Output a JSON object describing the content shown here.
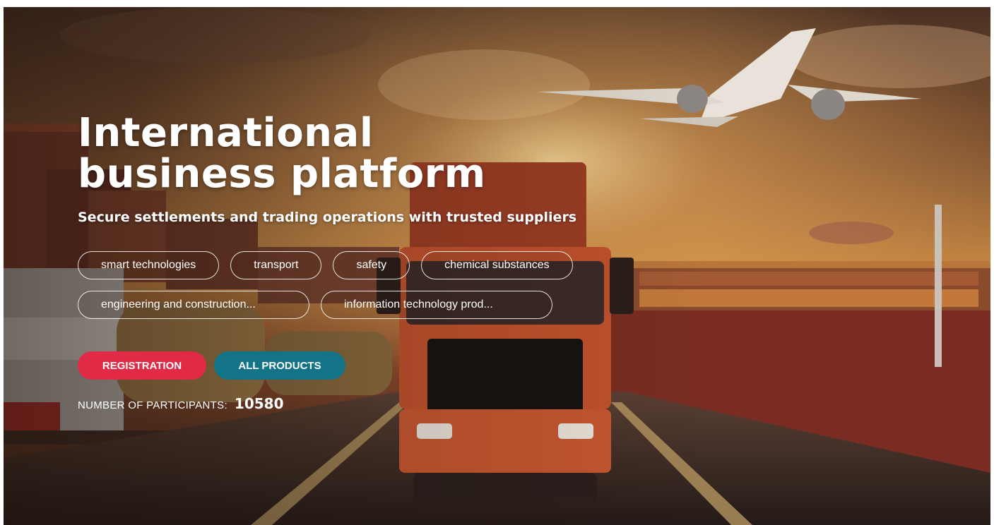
{
  "hero": {
    "title_line1": "International",
    "title_line2": "business platform",
    "subtitle": "Secure settlements and trading operations with trusted suppliers"
  },
  "categories": [
    "smart technologies",
    "transport",
    "safety",
    "chemical substances",
    "engineering and construction...",
    "information technology prod..."
  ],
  "actions": {
    "registration_label": "REGISTRATION",
    "all_products_label": "ALL PRODUCTS"
  },
  "stats": {
    "participants_label": "NUMBER OF PARTICIPANTS:",
    "participants_count": "10580"
  },
  "colors": {
    "registration_button": "#e12a45",
    "all_products_button": "#137387",
    "text": "#ffffff"
  }
}
